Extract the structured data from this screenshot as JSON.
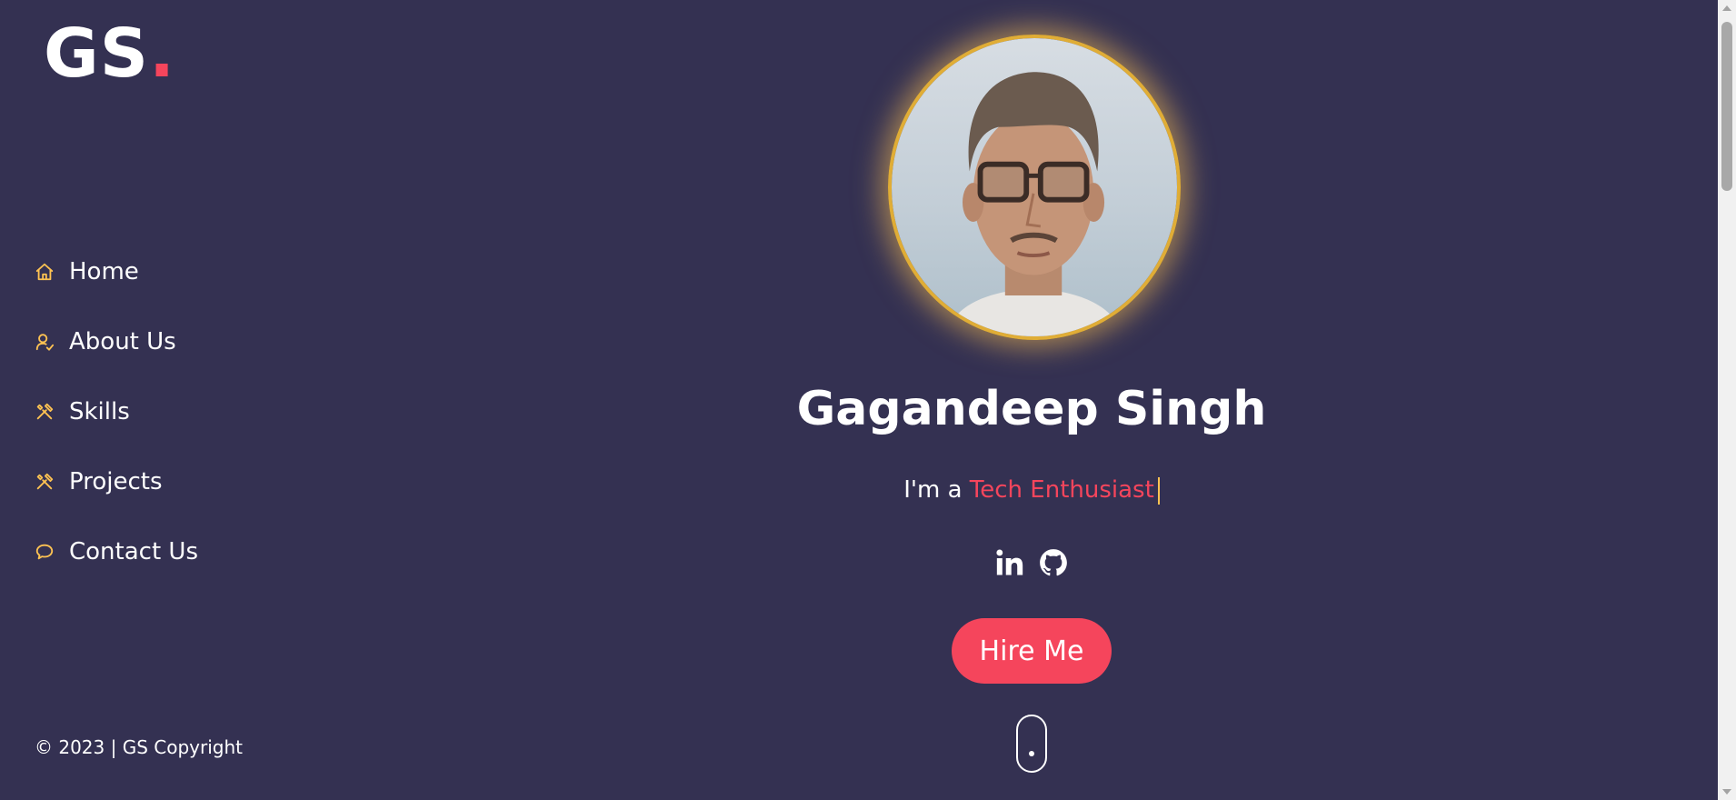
{
  "logo": {
    "text": "GS",
    "dot": "."
  },
  "sidebar": {
    "items": [
      {
        "label": "Home",
        "icon": "home-icon"
      },
      {
        "label": "About Us",
        "icon": "user-check-icon"
      },
      {
        "label": "Skills",
        "icon": "tools-icon"
      },
      {
        "label": "Projects",
        "icon": "tools-icon"
      },
      {
        "label": "Contact Us",
        "icon": "chat-bubble-icon"
      }
    ],
    "copyright": "© 2023 | GS Copyright"
  },
  "hero": {
    "name": "Gagandeep Singh",
    "tagline_prefix": "I'm a ",
    "tagline_highlight": "Tech Enthusiast",
    "socials": [
      {
        "icon": "linkedin-icon"
      },
      {
        "icon": "github-icon"
      }
    ],
    "hire_button": "Hire Me",
    "avatar": "profile-photo"
  },
  "colors": {
    "background": "#343152",
    "accent": "#f5455c",
    "icon_gold": "#ffc352",
    "text": "#ffffff"
  }
}
